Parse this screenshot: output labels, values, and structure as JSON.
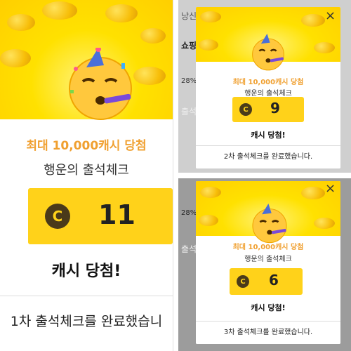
{
  "colors": {
    "accent_orange": "#f0a030",
    "box_yellow": "#ffd21a",
    "hero_yellow": "#ffe100"
  },
  "icons": {
    "emoji": "partying-face",
    "coin": "cash-c-icon",
    "close": "close-icon"
  },
  "background_app": {
    "title_fragment": "낭신",
    "shop_tab": "쇼핑",
    "percent": "28%",
    "check_tab": "출석"
  },
  "popups": [
    {
      "prize_title": "최대 10,000캐시 당첨",
      "subtitle": "행운의 출석체크",
      "coin_letter": "C",
      "cash_amount": "11",
      "win_text": "캐시 당첨!",
      "footer": "1차 출석체크를 완료했습니"
    },
    {
      "prize_title": "최대 10,000캐시 당첨",
      "subtitle": "행운의 출석체크",
      "coin_letter": "C",
      "cash_amount": "9",
      "win_text": "캐시 당첨!",
      "footer": "2차 출석체크를 완료했습니다.",
      "close": "×"
    },
    {
      "prize_title": "최대 10,000캐시 당첨",
      "subtitle": "행운의 출석체크",
      "coin_letter": "C",
      "cash_amount": "6",
      "win_text": "캐시 당첨!",
      "footer": "3차 출석체크를 완료했습니다.",
      "close": "×"
    }
  ]
}
